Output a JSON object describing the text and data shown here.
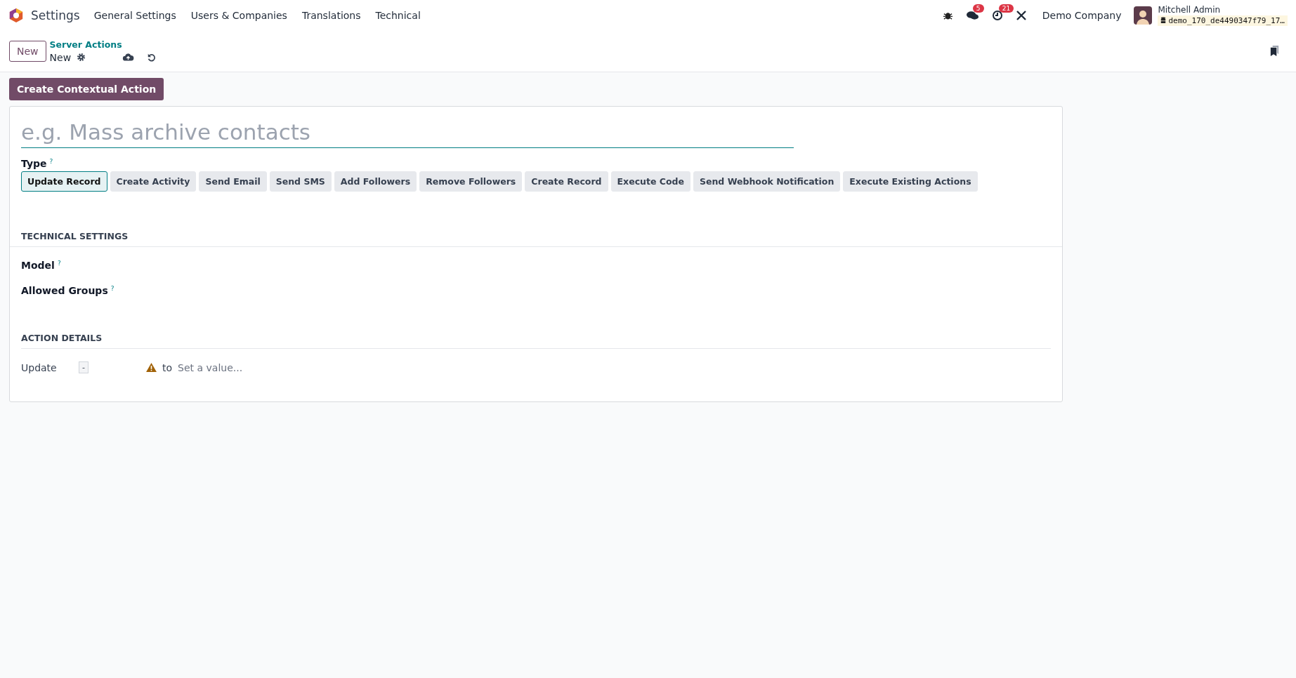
{
  "navbar": {
    "app_name": "Settings",
    "menu": [
      "General Settings",
      "Users & Companies",
      "Translations",
      "Technical"
    ],
    "messages_badge": "5",
    "activities_badge": "21",
    "company": "Demo Company",
    "user_name": "Mitchell Admin",
    "database": "demo_170_de4490347f79_17…"
  },
  "control_panel": {
    "new_button": "New",
    "breadcrumb": "Server Actions",
    "record_name": "New"
  },
  "action_button": "Create Contextual Action",
  "form": {
    "name_placeholder": "e.g. Mass archive contacts",
    "type_label": "Type",
    "type_help": "?",
    "types": [
      {
        "label": "Update Record",
        "selected": true
      },
      {
        "label": "Create Activity",
        "selected": false
      },
      {
        "label": "Send Email",
        "selected": false
      },
      {
        "label": "Send SMS",
        "selected": false
      },
      {
        "label": "Add Followers",
        "selected": false
      },
      {
        "label": "Remove Followers",
        "selected": false
      },
      {
        "label": "Create Record",
        "selected": false
      },
      {
        "label": "Execute Code",
        "selected": false
      },
      {
        "label": "Send Webhook Notification",
        "selected": false
      },
      {
        "label": "Execute Existing Actions",
        "selected": false
      }
    ],
    "technical_settings": {
      "title": "TECHNICAL SETTINGS",
      "fields": [
        {
          "label": "Model",
          "help": "?"
        },
        {
          "label": "Allowed Groups",
          "help": "?"
        }
      ]
    },
    "action_details": {
      "title": "ACTION DETAILS",
      "update_label": "Update",
      "field_value": "-",
      "to_label": "to",
      "value_placeholder": "Set a value..."
    }
  }
}
